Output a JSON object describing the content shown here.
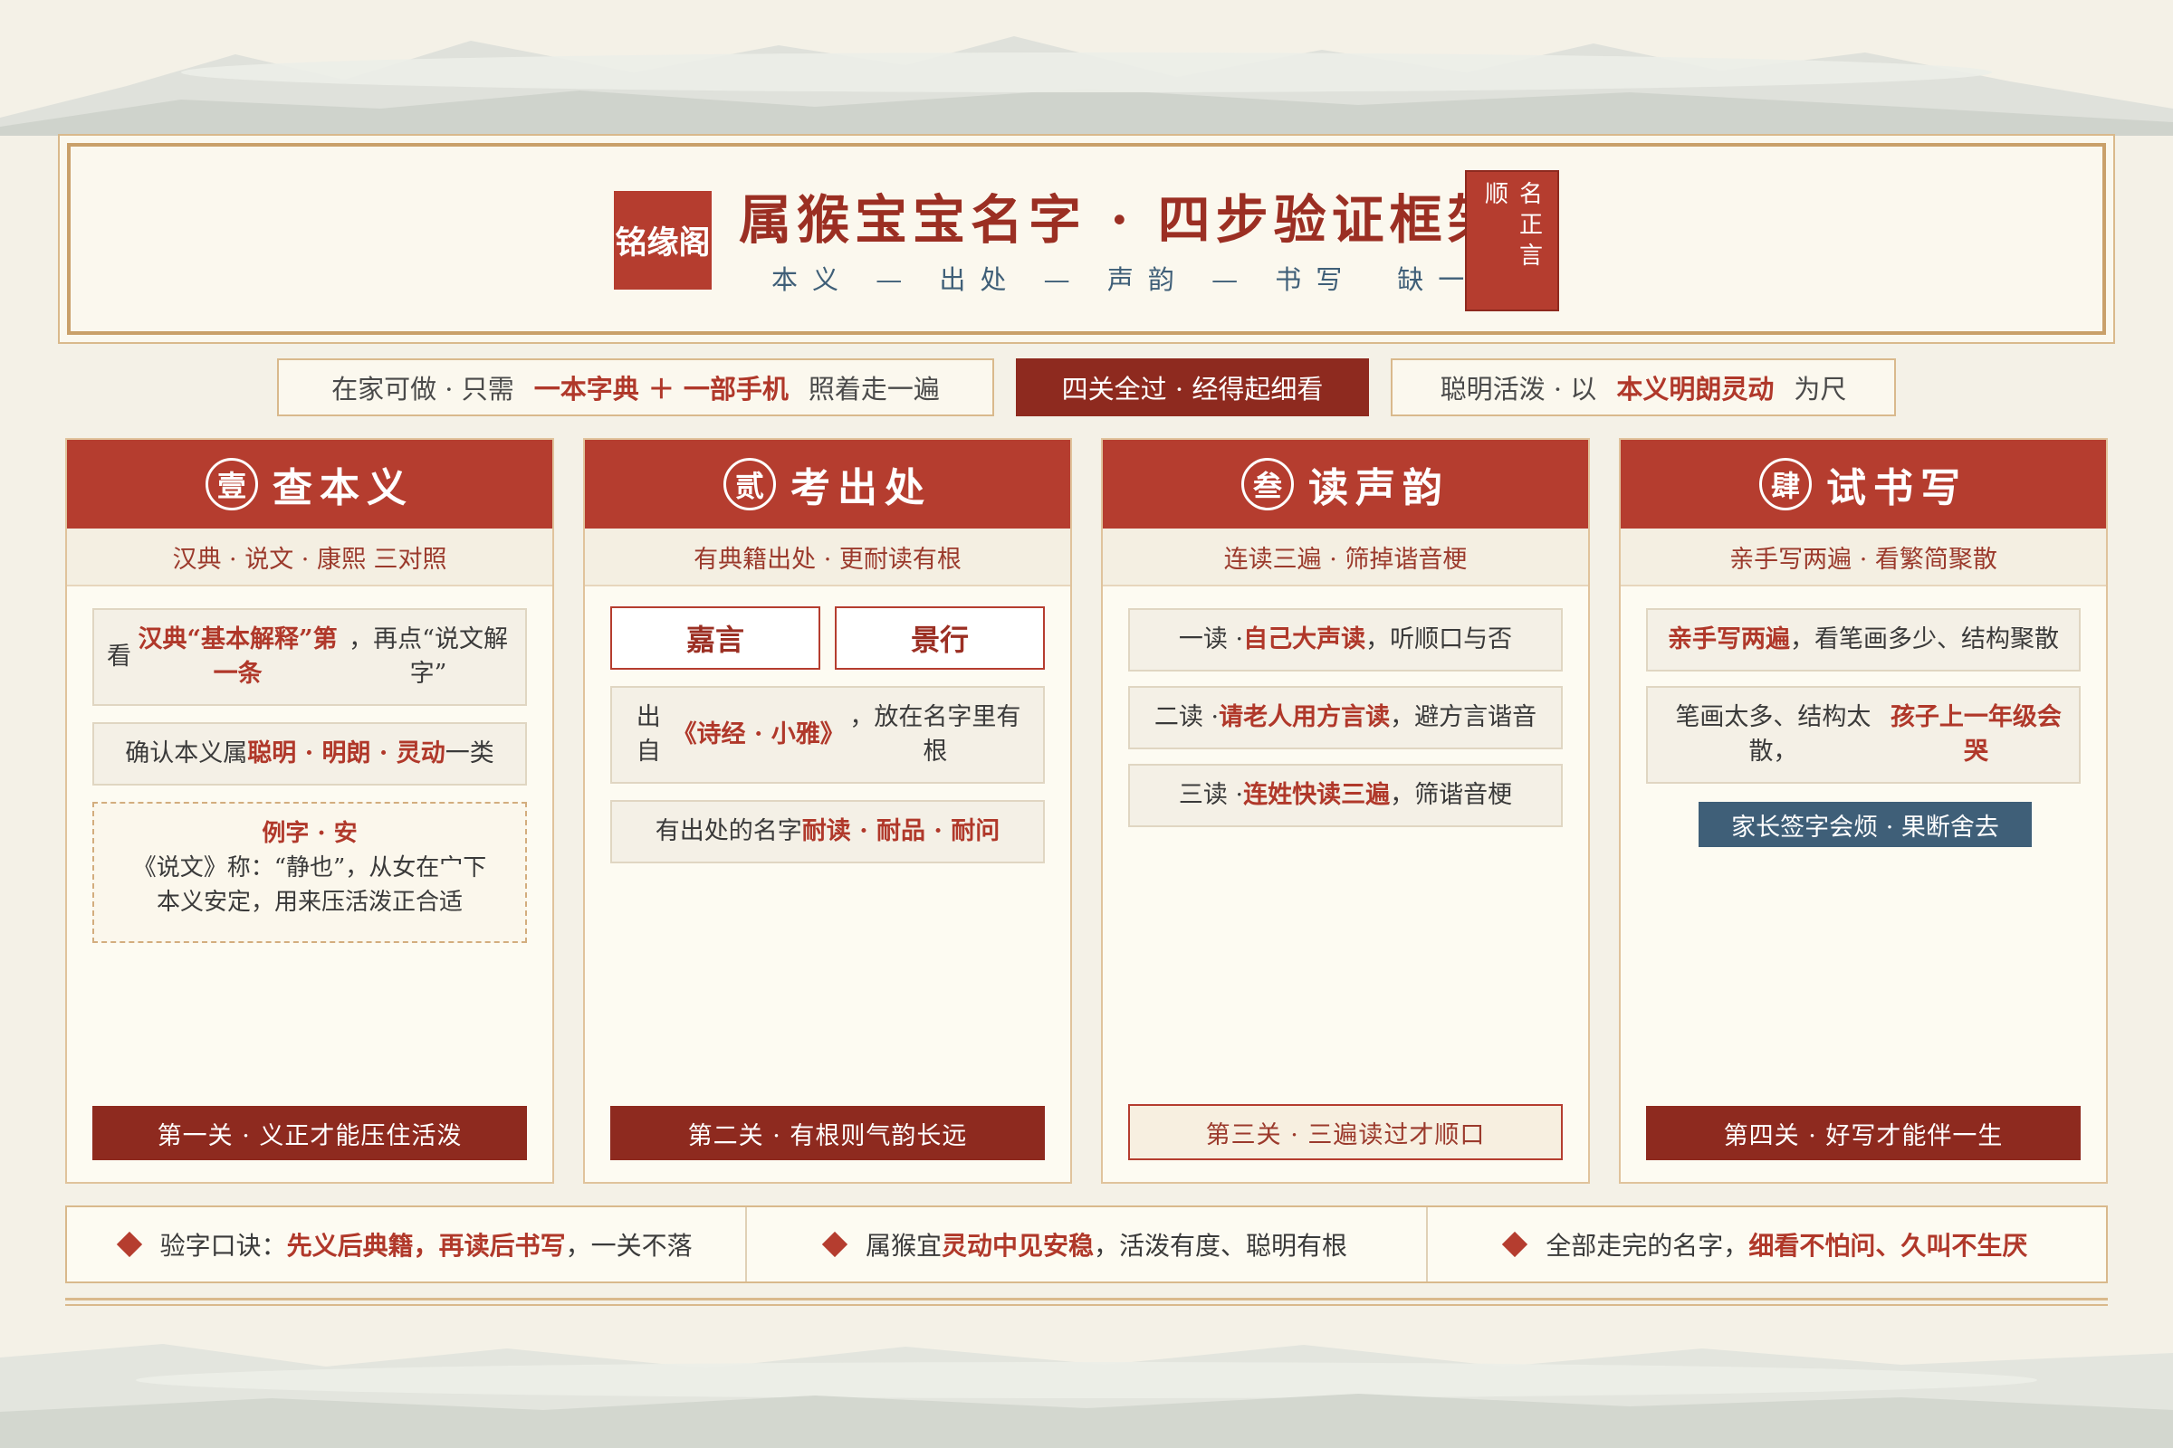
{
  "header": {
    "logo": "铭缘阁",
    "title": "属猴宝宝名字 · 四步验证框架",
    "subtitle": "本义 — 出处 — 声韵 — 书写　缺一不可",
    "stamp": "名正言顺"
  },
  "chips": [
    {
      "pre": "在家可做 · 只需",
      "hl": "一本字典 ＋ 一部手机",
      "post": "照着走一遍"
    },
    {
      "text": "四关全过 · 经得起细看"
    },
    {
      "pre": "聪明活泼 · 以",
      "hl": "本义明朗灵动",
      "post": "为尺"
    }
  ],
  "cards": [
    {
      "num": "壹",
      "title": "查本义",
      "sub": "汉典 · 说文 · 康熙 三对照",
      "items": [
        {
          "pre": "看",
          "hl": "汉典“基本解释”第一条",
          "post": "，再点“说文解字”"
        },
        {
          "pre": "确认本义属",
          "hl": "聪明 · 明朗 · 灵动",
          "post": "一类"
        }
      ],
      "example": {
        "title": "例字 · 安",
        "line1": "《说文》称：“静也”，从女在宀下",
        "line2": "本义安定，用来压活泼正合适"
      },
      "foot": "第一关 · 义正才能压住活泼"
    },
    {
      "num": "贰",
      "title": "考出处",
      "sub": "有典籍出处 · 更耐读有根",
      "names": [
        "嘉言",
        "景行"
      ],
      "items": [
        {
          "pre": "出自",
          "hl": "《诗经 · 小雅》",
          "post": "，放在名字里有根"
        },
        {
          "pre": "有出处的名字",
          "hl": "耐读 · 耐品 · 耐问",
          "post": ""
        }
      ],
      "foot": "第二关 · 有根则气韵长远"
    },
    {
      "num": "叁",
      "title": "读声韵",
      "sub": "连读三遍 · 筛掉谐音梗",
      "items": [
        {
          "pre": "一读 · ",
          "hl": "自己大声读",
          "post": "，听顺口与否"
        },
        {
          "pre": "二读 · ",
          "hl": "请老人用方言读",
          "post": "，避方言谐音"
        },
        {
          "pre": "三读 · ",
          "hl": "连姓快读三遍",
          "post": "，筛谐音梗"
        }
      ],
      "foot": "第三关 · 三遍读过才顺口"
    },
    {
      "num": "肆",
      "title": "试书写",
      "sub": "亲手写两遍 · 看繁简聚散",
      "items": [
        {
          "pre": "",
          "hl": "亲手写两遍",
          "post": "，看笔画多少、结构聚散"
        },
        {
          "pre": "笔画太多、结构太散，",
          "hl": "孩子上一年级会哭",
          "post": ""
        }
      ],
      "tag": "家长签字会烦 · 果断舍去",
      "foot": "第四关 · 好写才能伴一生"
    }
  ],
  "bottom": [
    {
      "pre": "验字口诀：",
      "hl": "先义后典籍，再读后书写",
      "post": "，一关不落"
    },
    {
      "pre": "属猴宜",
      "hl": "灵动中见安稳",
      "post": "，活泼有度、聪明有根"
    },
    {
      "pre": "全部走完的名字，",
      "hl": "细看不怕问、久叫不生厌",
      "post": ""
    }
  ],
  "colors": {
    "primary": "#b53d2f",
    "dark": "#8e2a1f",
    "gold": "#c9a06a",
    "blue": "#3f5f78",
    "paper": "#f4f1e7"
  }
}
